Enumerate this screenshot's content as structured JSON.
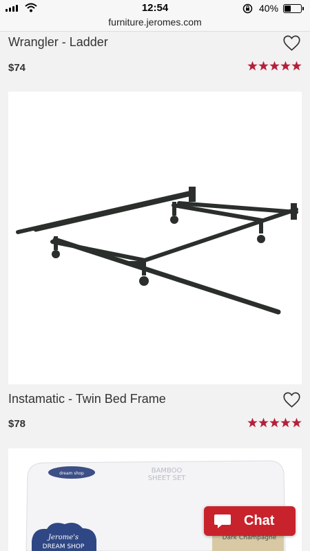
{
  "status_bar": {
    "time": "12:54",
    "battery_percent_text": "40%",
    "battery_level": 0.4,
    "icons": [
      "signal-icon",
      "wifi-icon",
      "orientation-lock-icon",
      "battery-icon"
    ]
  },
  "browser": {
    "url": "furniture.jeromes.com"
  },
  "products": [
    {
      "title": "Wrangler - Ladder",
      "price": "$74",
      "rating": 5,
      "max_rating": 5
    },
    {
      "title": "Instamatic - Twin Bed Frame",
      "price": "$78",
      "rating": 5,
      "max_rating": 5
    }
  ],
  "next_product_image": {
    "box_text_top": "BAMBOO",
    "box_text_bottom": "SHEET SET",
    "logo_line1": "Jerome's",
    "logo_line2": "DREAM SHOP",
    "badge_text": "Dark Champagne"
  },
  "chat": {
    "label": "Chat"
  },
  "colors": {
    "accent": "#c8232c",
    "star": "#b5203a",
    "background": "#f2f2f2"
  }
}
